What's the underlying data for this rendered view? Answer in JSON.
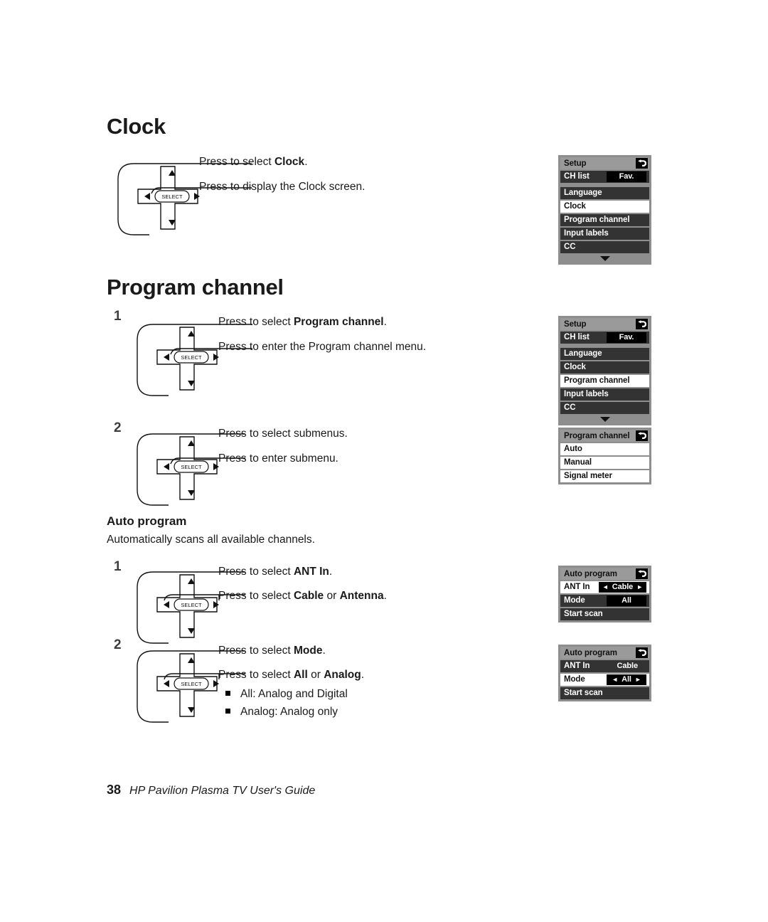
{
  "page": {
    "number": "38",
    "footer_title": "HP Pavilion Plasma TV User's Guide"
  },
  "sections": [
    {
      "heading": "Clock",
      "steps": [
        {
          "number": "",
          "navpad_variant": "vertical",
          "callouts": [
            {
              "pre": "Press to select ",
              "bold": "Clock",
              "post": "."
            },
            {
              "pre": "Press to display the Clock screen.",
              "bold": "",
              "post": ""
            }
          ]
        }
      ]
    },
    {
      "heading": "Program channel",
      "steps": [
        {
          "number": "1",
          "navpad_variant": "vertical",
          "callouts": [
            {
              "pre": "Press to select ",
              "bold": "Program channel",
              "post": "."
            },
            {
              "pre": "Press to enter the Program channel menu.",
              "bold": "",
              "post": ""
            }
          ]
        },
        {
          "number": "2",
          "navpad_variant": "vertical",
          "callouts": [
            {
              "pre": "Press to select submenus.",
              "bold": "",
              "post": ""
            },
            {
              "pre": "Press to enter submenu.",
              "bold": "",
              "post": ""
            }
          ]
        }
      ]
    }
  ],
  "autoprogram": {
    "heading": "Auto program",
    "description": "Automatically scans all available channels.",
    "steps": [
      {
        "number": "1",
        "navpad_variant": "horizontal",
        "callouts": [
          {
            "pre": "Press to select ",
            "bold": "ANT In",
            "post": "."
          },
          {
            "pre": "Press to select ",
            "bold": "Cable",
            "mid": " or ",
            "bold2": "Antenna",
            "post": "."
          }
        ]
      },
      {
        "number": "2",
        "navpad_variant": "horizontal",
        "callouts": [
          {
            "pre": "Press to select ",
            "bold": "Mode",
            "post": "."
          },
          {
            "pre": "Press to select ",
            "bold": "All",
            "mid": " or ",
            "bold2": "Analog",
            "post": "."
          }
        ],
        "bullets": [
          "All: Analog and Digital",
          "Analog: Analog only"
        ]
      }
    ]
  },
  "navpad": {
    "select_label": "SELECT"
  },
  "osd_menus": [
    {
      "id": "setup-clock",
      "title": "Setup",
      "back_icon": "back-arrow-icon",
      "rows": [
        {
          "label": "CH list",
          "value": "Fav.",
          "value_style": "box",
          "selected": false,
          "gap": false
        },
        {
          "label": "Language",
          "value": "",
          "value_style": "none",
          "selected": false,
          "gap": true
        },
        {
          "label": "Clock",
          "value": "",
          "value_style": "none",
          "selected": true,
          "gap": false
        },
        {
          "label": "Program channel",
          "value": "",
          "value_style": "none",
          "selected": false,
          "gap": false
        },
        {
          "label": "Input labels",
          "value": "",
          "value_style": "none",
          "selected": false,
          "gap": false
        },
        {
          "label": "CC",
          "value": "",
          "value_style": "none",
          "selected": false,
          "gap": false
        }
      ],
      "scroll_down": true
    },
    {
      "id": "setup-program-channel",
      "title": "Setup",
      "back_icon": "back-arrow-icon",
      "rows": [
        {
          "label": "CH list",
          "value": "Fav.",
          "value_style": "box",
          "selected": false,
          "gap": false
        },
        {
          "label": "Language",
          "value": "",
          "value_style": "none",
          "selected": false,
          "gap": true
        },
        {
          "label": "Clock",
          "value": "",
          "value_style": "none",
          "selected": false,
          "gap": false
        },
        {
          "label": "Program channel",
          "value": "",
          "value_style": "none",
          "selected": true,
          "gap": false
        },
        {
          "label": "Input labels",
          "value": "",
          "value_style": "none",
          "selected": false,
          "gap": false
        },
        {
          "label": "CC",
          "value": "",
          "value_style": "none",
          "selected": false,
          "gap": false
        }
      ],
      "scroll_down": true
    },
    {
      "id": "program-channel-submenu",
      "title": "Program channel",
      "back_icon": "back-arrow-icon",
      "rows": [
        {
          "label": "Auto",
          "value": "",
          "value_style": "none",
          "selected": true,
          "gap": false
        },
        {
          "label": "Manual",
          "value": "",
          "value_style": "none",
          "selected": true,
          "gap": false
        },
        {
          "label": "Signal meter",
          "value": "",
          "value_style": "none",
          "selected": true,
          "gap": false
        }
      ],
      "scroll_down": false
    },
    {
      "id": "auto-program-antin",
      "title": "Auto program",
      "back_icon": "back-arrow-icon",
      "rows": [
        {
          "label": "ANT In",
          "value": "Cable",
          "value_style": "box-arrows",
          "selected": true,
          "gap": false
        },
        {
          "label": "Mode",
          "value": "All",
          "value_style": "box",
          "selected": false,
          "gap": false
        },
        {
          "label": "Start scan",
          "value": "",
          "value_style": "none",
          "selected": false,
          "gap": false
        }
      ],
      "scroll_down": false
    },
    {
      "id": "auto-program-mode",
      "title": "Auto program",
      "back_icon": "back-arrow-icon",
      "rows": [
        {
          "label": "ANT In",
          "value": "Cable",
          "value_style": "plain",
          "selected": false,
          "gap": false
        },
        {
          "label": "Mode",
          "value": "All",
          "value_style": "box-arrows",
          "selected": true,
          "gap": false
        },
        {
          "label": "Start scan",
          "value": "",
          "value_style": "none",
          "selected": false,
          "gap": false
        }
      ],
      "scroll_down": false
    }
  ],
  "arrows": {
    "left": "◄",
    "right": "►"
  }
}
